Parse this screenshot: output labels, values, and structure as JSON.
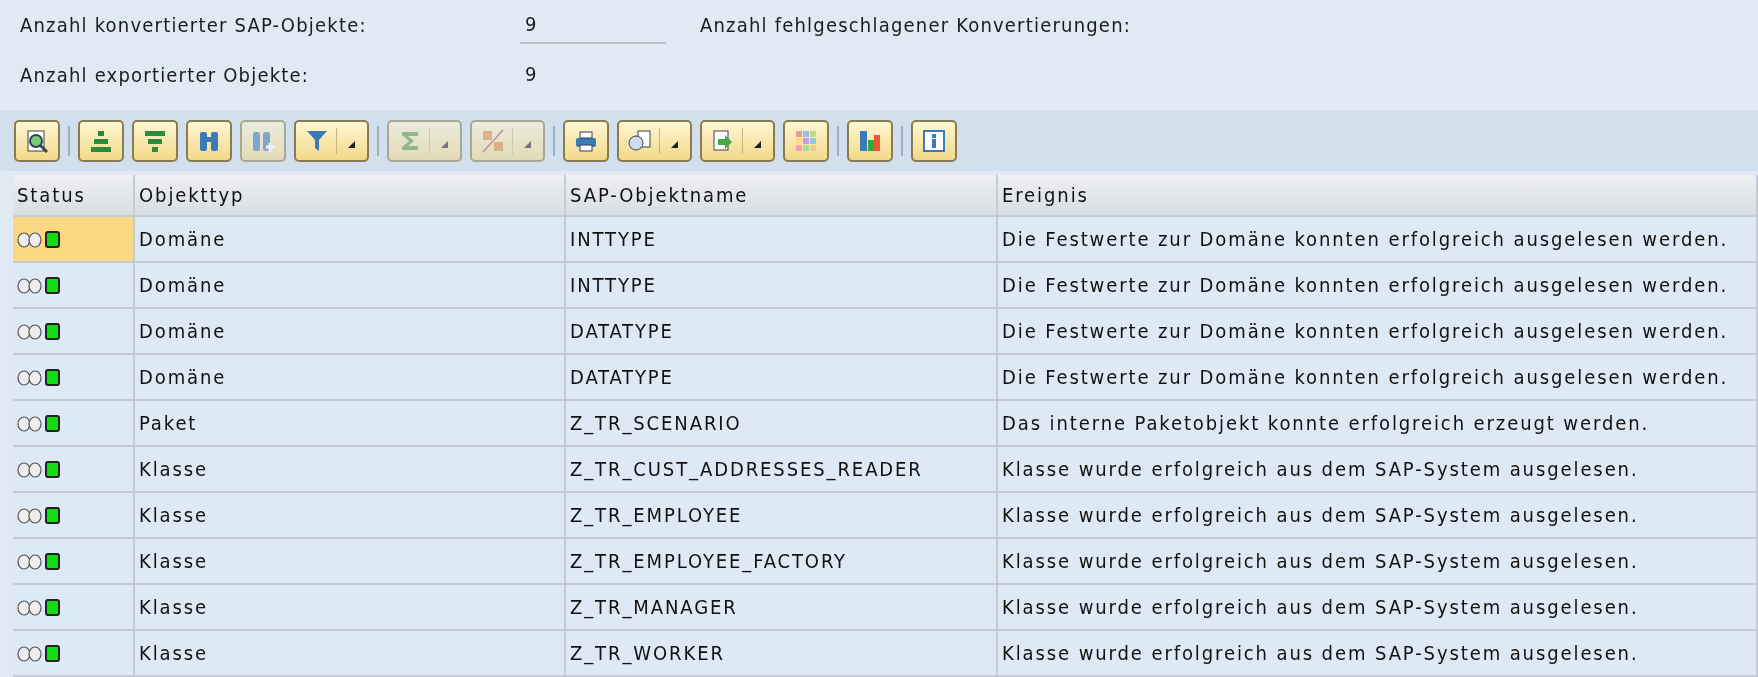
{
  "summary": [
    {
      "label": "Anzahl konvertierter SAP-Objekte:",
      "value": "9",
      "kind": "field",
      "label_2": "Anzahl fehlgeschlagener Konvertierungen:"
    },
    {
      "label": "Anzahl exportierter Objekte:",
      "value": "9",
      "kind": "text"
    }
  ],
  "toolbar": [
    [
      {
        "disabled": false,
        "menu": false
      }
    ],
    [
      {
        "disabled": false,
        "menu": false
      },
      {
        "disabled": false,
        "menu": false
      },
      {
        "disabled": false,
        "menu": false
      },
      {
        "disabled": true,
        "menu": false
      },
      {
        "disabled": false,
        "menu": true
      }
    ],
    [
      {
        "disabled": true,
        "menu": true
      },
      {
        "disabled": true,
        "menu": true
      }
    ],
    [
      {
        "disabled": false,
        "menu": false
      },
      {
        "disabled": false,
        "menu": true
      },
      {
        "disabled": false,
        "menu": true
      },
      {
        "disabled": false,
        "menu": false
      }
    ],
    [
      {
        "disabled": false,
        "menu": false
      }
    ],
    [
      {
        "disabled": false,
        "menu": false
      }
    ]
  ],
  "table": {
    "columns": [
      "Status",
      "Objekttyp",
      "SAP-Objektname",
      "Ereignis"
    ],
    "rows": [
      {
        "color": "#11dd11",
        "selected": true,
        "type": "Domäne",
        "name": "INTTYPE",
        "event": "Die Festwerte zur Domäne konnten erfolgreich ausgelesen werden."
      },
      {
        "color": "#11dd11",
        "selected": false,
        "type": "Domäne",
        "name": "INTTYPE",
        "event": "Die Festwerte zur Domäne konnten erfolgreich ausgelesen werden."
      },
      {
        "color": "#11dd11",
        "selected": false,
        "type": "Domäne",
        "name": "DATATYPE",
        "event": "Die Festwerte zur Domäne konnten erfolgreich ausgelesen werden."
      },
      {
        "color": "#11dd11",
        "selected": false,
        "type": "Domäne",
        "name": "DATATYPE",
        "event": "Die Festwerte zur Domäne konnten erfolgreich ausgelesen werden."
      },
      {
        "color": "#11dd11",
        "selected": false,
        "type": "Paket",
        "name": "Z_TR_SCENARIO",
        "event": "Das interne Paketobjekt konnte erfolgreich erzeugt werden."
      },
      {
        "color": "#11dd11",
        "selected": false,
        "type": "Klasse",
        "name": "Z_TR_CUST_ADDRESSES_READER",
        "event": "Klasse wurde erfolgreich aus dem SAP-System ausgelesen."
      },
      {
        "color": "#11dd11",
        "selected": false,
        "type": "Klasse",
        "name": "Z_TR_EMPLOYEE",
        "event": "Klasse wurde erfolgreich aus dem SAP-System ausgelesen."
      },
      {
        "color": "#11dd11",
        "selected": false,
        "type": "Klasse",
        "name": "Z_TR_EMPLOYEE_FACTORY",
        "event": "Klasse wurde erfolgreich aus dem SAP-System ausgelesen."
      },
      {
        "color": "#11dd11",
        "selected": false,
        "type": "Klasse",
        "name": "Z_TR_MANAGER",
        "event": "Klasse wurde erfolgreich aus dem SAP-System ausgelesen."
      },
      {
        "color": "#11dd11",
        "selected": false,
        "type": "Klasse",
        "name": "Z_TR_WORKER",
        "event": "Klasse wurde erfolgreich aus dem SAP-System ausgelesen."
      }
    ]
  }
}
